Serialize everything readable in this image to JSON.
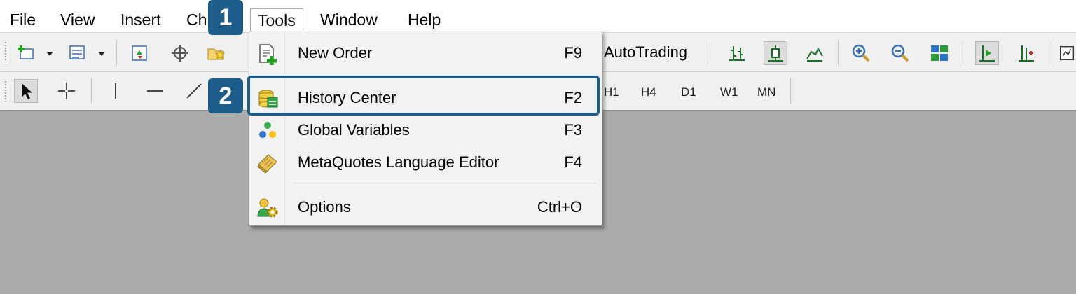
{
  "menubar": {
    "items": [
      {
        "label": "File"
      },
      {
        "label": "View"
      },
      {
        "label": "Insert"
      },
      {
        "label": "Ch"
      },
      {
        "label": "Tools"
      },
      {
        "label": "Window"
      },
      {
        "label": "Help"
      }
    ]
  },
  "toolbar": {
    "autotrading_label": "AutoTrading",
    "timeframes": [
      "H1",
      "H4",
      "D1",
      "W1",
      "MN"
    ]
  },
  "tools_menu": {
    "items": [
      {
        "label": "New Order",
        "shortcut": "F9",
        "icon": "new-order-icon"
      },
      {
        "label": "History Center",
        "shortcut": "F2",
        "icon": "history-center-icon"
      },
      {
        "label": "Global Variables",
        "shortcut": "F3",
        "icon": "global-variables-icon"
      },
      {
        "label": "MetaQuotes Language Editor",
        "shortcut": "F4",
        "icon": "metaeditor-icon"
      },
      {
        "label": "Options",
        "shortcut": "Ctrl+O",
        "icon": "options-icon"
      }
    ]
  },
  "annotations": {
    "step1": "1",
    "step2": "2"
  },
  "colors": {
    "accent": "#1e5d8a",
    "chart_bg": "#ababab",
    "toolbar_bg": "#f0f0f0"
  }
}
